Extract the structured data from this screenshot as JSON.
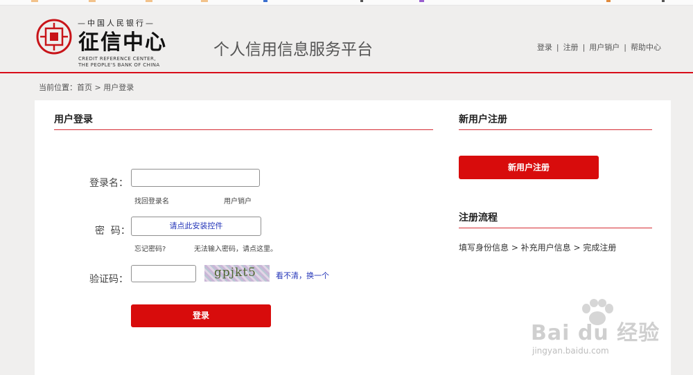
{
  "colors": {
    "accent": "#d80c18",
    "link": "#2334b8",
    "button": "#d80c0c"
  },
  "logo": {
    "slogan": "—中国人民银行—",
    "title": "征信中心",
    "en_line1": "CREDIT REFERENCE CENTER,",
    "en_line2": "THE PEOPLE'S BANK OF CHINA",
    "icon": "credit-center-emblem-icon"
  },
  "platform_title": "个人信用信息服务平台",
  "topnav": {
    "login": "登录",
    "register": "注册",
    "cancel_account": "用户销户",
    "help": "帮助中心",
    "separator": "|"
  },
  "breadcrumb": {
    "prefix": "当前位置：",
    "home": "首页",
    "separator": " > ",
    "current": "用户登录"
  },
  "login": {
    "title": "用户登录",
    "username_label": "登录名：",
    "username_value": "",
    "find_username": "找回登录名",
    "cancel_account": "用户销户",
    "password_label": "密  码：",
    "password_control": "请点此安装控件",
    "forgot_password": "忘记密码?",
    "cannot_input": "无法输入密码，请点这里。",
    "captcha_label": "验证码：",
    "captcha_value": "",
    "captcha_text": "gpjkt5",
    "refresh_captcha": "看不清，换一个",
    "submit": "登录"
  },
  "register": {
    "title": "新用户注册",
    "button": "新用户注册",
    "flow_title": "注册流程",
    "flow_steps": "填写身份信息 > 补充用户信息 > 完成注册"
  },
  "watermark": {
    "text": "Bai du 经验",
    "url": "jingyan.baidu.com",
    "icon": "baidu-paw-icon"
  }
}
